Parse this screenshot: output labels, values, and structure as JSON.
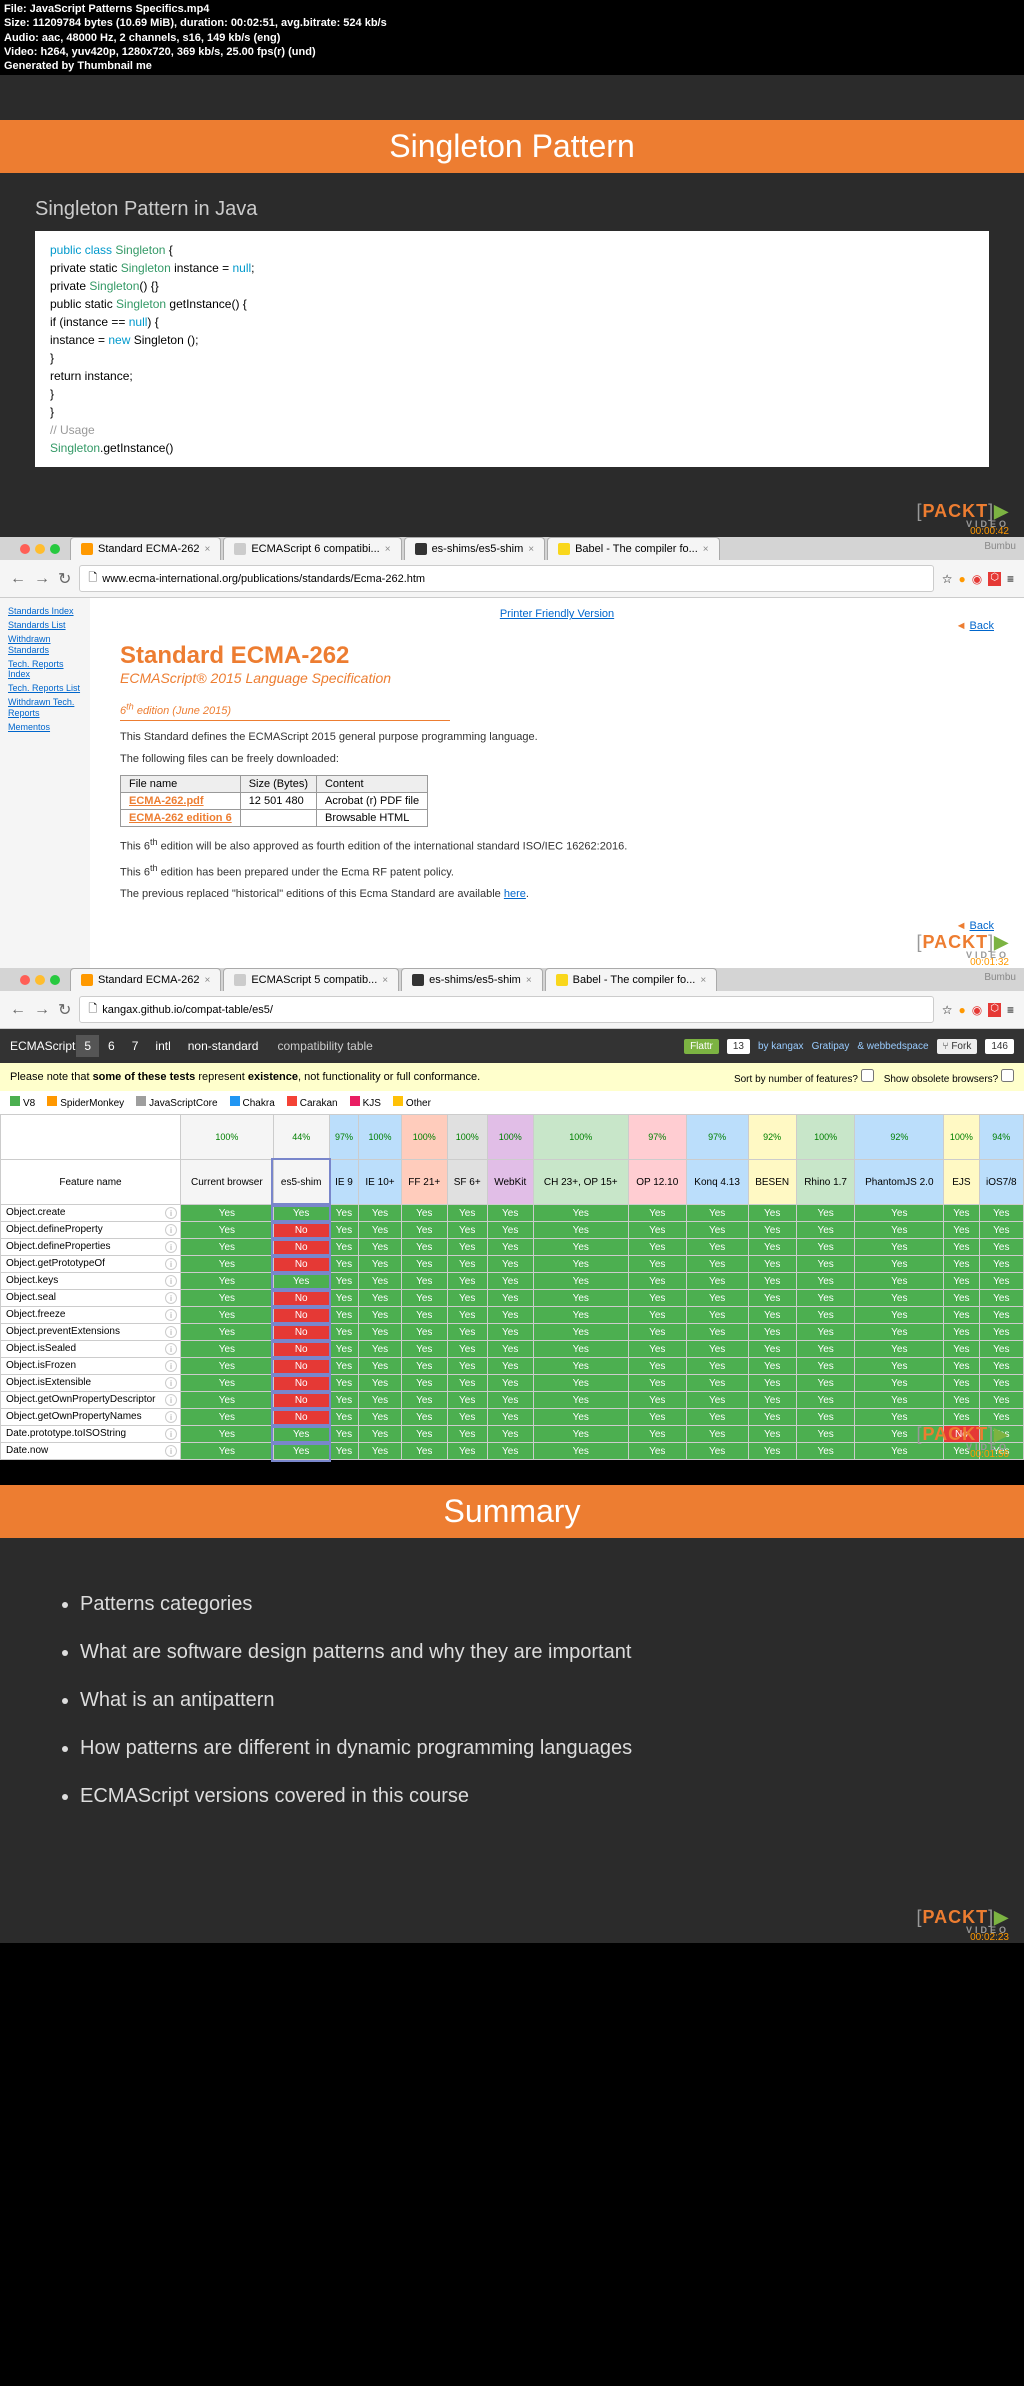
{
  "header": {
    "file": "JavaScript Patterns Specifics.mp4",
    "size": "11209784 bytes (10.69 MiB), duration: 00:02:51, avg.bitrate: 524 kb/s",
    "audio": "aac, 48000 Hz, 2 channels, s16, 149 kb/s (eng)",
    "video": "h264, yuv420p, 1280x720, 369 kb/s, 25.00 fps(r) (und)",
    "gen": "Generated by Thumbnail me"
  },
  "slide1": {
    "banner": "Singleton Pattern",
    "subtitle": "Singleton Pattern in Java",
    "timestamp": "00:00:42"
  },
  "code": {
    "l1a": "public class",
    "l1b": "Singleton",
    "l1c": " {",
    "l2a": "  private static ",
    "l2b": "Singleton",
    "l2c": " instance = ",
    "l2d": "null",
    "l2e": ";",
    "l3": " ",
    "l4a": "  private ",
    "l4b": "Singleton",
    "l4c": "() {}",
    "l5": " ",
    "l6a": "  public static ",
    "l6b": "Singleton",
    "l6c": " getInstance() {",
    "l7a": "    if (instance == ",
    "l7b": "null",
    "l7c": ") {",
    "l8a": "      instance = ",
    "l8b": "new",
    "l8c": " Singleton ();",
    "l9": "    }",
    "l10": "    return instance;",
    "l11": "  }",
    "l12": "}",
    "l13": " ",
    "l14": "// Usage",
    "l15a": "Singleton",
    "l15b": ".getInstance()"
  },
  "browser": {
    "tabs": [
      {
        "title": "Standard ECMA-262"
      },
      {
        "title": "ECMAScript 6 compatibi..."
      },
      {
        "title": "es-shims/es5-shim"
      },
      {
        "title": "Babel - The compiler fo..."
      }
    ],
    "url1": "www.ecma-international.org/publications/standards/Ecma-262.htm",
    "url2": "kangax.github.io/compat-table/es5/",
    "burmbu": "Bumbu"
  },
  "ecma": {
    "sidebar": [
      "Standards Index",
      "Standards List",
      "Withdrawn Standards",
      "Tech. Reports Index",
      "Tech. Reports List",
      "Withdrawn Tech. Reports",
      "Mementos"
    ],
    "printer": "Printer Friendly Version",
    "back": "Back",
    "title": "Standard ECMA-262",
    "sub": "ECMAScript® 2015 Language Specification",
    "ed": "6th edition (June 2015)",
    "p1": "This Standard defines the ECMAScript 2015 general purpose programming language.",
    "p2": "The following files can be freely downloaded:",
    "th1": "File name",
    "th2": "Size (Bytes)",
    "th3": "Content",
    "r1c1": "ECMA-262.pdf",
    "r1c2": "12 501 480",
    "r1c3": "Acrobat (r) PDF file",
    "r2c1": "ECMA-262 edition 6",
    "r2c2": "",
    "r2c3": "Browsable HTML",
    "p3a": "This 6",
    "p3b": " edition will be also approved as fourth edition of the international standard ISO/IEC 16262:2016.",
    "p4a": "This 6",
    "p4b": " edition has been prepared under the Ecma RF patent policy.",
    "p5a": "The previous replaced \"historical\" editions of this Ecma Standard are available ",
    "p5b": "here",
    "p5c": ".",
    "timestamp": "00:01:32"
  },
  "compat": {
    "nav_label": "ECMAScript",
    "nav_items": [
      "5",
      "6",
      "7",
      "intl",
      "non-standard"
    ],
    "nav_title": "compatibility table",
    "flattr": "Flattr",
    "flattr_n": "13",
    "by": "by kangax",
    "grat": "Gratipay",
    "webbed": "& webbedspace",
    "fork": "Fork",
    "fork_n": "146",
    "note": "Please note that some of these tests represent existence, not functionality or full conformance.",
    "sort_label": "Sort by number of features?",
    "obs_label": "Show obsolete browsers?",
    "legend": [
      "V8",
      "SpiderMonkey",
      "JavaScriptCore",
      "Chakra",
      "Carakan",
      "KJS",
      "Other"
    ],
    "legend_colors": [
      "#4caf50",
      "#ff9800",
      "#9e9e9e",
      "#2196f3",
      "#f44336",
      "#e91e63",
      "#ffc107"
    ],
    "col_feat": "Feature name",
    "cols": [
      "Current browser",
      "es5-shim",
      "IE 9",
      "IE 10+",
      "FF 21+",
      "SF 6+",
      "WebKit",
      "CH 23+, OP 15+",
      "OP 12.10",
      "Konq 4.13",
      "BESEN",
      "Rhino 1.7",
      "PhantomJS 2.0",
      "EJS",
      "iOS7/8"
    ],
    "pcts": [
      "100%",
      "44%",
      "97%",
      "100%",
      "100%",
      "100%",
      "100%",
      "100%",
      "97%",
      "97%",
      "92%",
      "100%",
      "92%",
      "100%",
      "94%",
      "100%"
    ],
    "features": [
      "Object.create",
      "Object.defineProperty",
      "Object.defineProperties",
      "Object.getPrototypeOf",
      "Object.keys",
      "Object.seal",
      "Object.freeze",
      "Object.preventExtensions",
      "Object.isSealed",
      "Object.isFrozen",
      "Object.isExtensible",
      "Object.getOwnPropertyDescriptor",
      "Object.getOwnPropertyNames",
      "Date.prototype.toISOString",
      "Date.now"
    ],
    "timestamp": "00:01:56"
  },
  "chart_data": {
    "type": "table",
    "title": "ECMAScript 5 compatibility table",
    "columns": [
      "Feature name",
      "Current browser",
      "es5-shim",
      "IE 9",
      "IE 10+",
      "FF 21+",
      "SF 6+",
      "WebKit",
      "CH 23+/OP 15+",
      "OP 12.10",
      "Konq 4.13",
      "BESEN",
      "Rhino 1.7",
      "PhantomJS 2.0",
      "EJS",
      "iOS7/8"
    ],
    "column_percentages": [
      null,
      100,
      44,
      97,
      100,
      100,
      100,
      100,
      100,
      97,
      97,
      92,
      100,
      92,
      100,
      94,
      100
    ],
    "rows": [
      {
        "feature": "Object.create",
        "values": [
          "Yes",
          "Yes",
          "Yes",
          "Yes",
          "Yes",
          "Yes",
          "Yes",
          "Yes",
          "Yes",
          "Yes",
          "Yes",
          "Yes",
          "Yes",
          "Yes",
          "Yes"
        ]
      },
      {
        "feature": "Object.defineProperty",
        "values": [
          "Yes",
          "No",
          "Yes",
          "Yes",
          "Yes",
          "Yes",
          "Yes",
          "Yes",
          "Yes",
          "Yes",
          "Yes",
          "Yes",
          "Yes",
          "Yes",
          "Yes"
        ]
      },
      {
        "feature": "Object.defineProperties",
        "values": [
          "Yes",
          "No",
          "Yes",
          "Yes",
          "Yes",
          "Yes",
          "Yes",
          "Yes",
          "Yes",
          "Yes",
          "Yes",
          "Yes",
          "Yes",
          "Yes",
          "Yes"
        ]
      },
      {
        "feature": "Object.getPrototypeOf",
        "values": [
          "Yes",
          "No",
          "Yes",
          "Yes",
          "Yes",
          "Yes",
          "Yes",
          "Yes",
          "Yes",
          "Yes",
          "Yes",
          "Yes",
          "Yes",
          "Yes",
          "Yes"
        ]
      },
      {
        "feature": "Object.keys",
        "values": [
          "Yes",
          "Yes",
          "Yes",
          "Yes",
          "Yes",
          "Yes",
          "Yes",
          "Yes",
          "Yes",
          "Yes",
          "Yes",
          "Yes",
          "Yes",
          "Yes",
          "Yes"
        ]
      },
      {
        "feature": "Object.seal",
        "values": [
          "Yes",
          "No",
          "Yes",
          "Yes",
          "Yes",
          "Yes",
          "Yes",
          "Yes",
          "Yes",
          "Yes",
          "Yes",
          "Yes",
          "Yes",
          "Yes",
          "Yes"
        ]
      },
      {
        "feature": "Object.freeze",
        "values": [
          "Yes",
          "No",
          "Yes",
          "Yes",
          "Yes",
          "Yes",
          "Yes",
          "Yes",
          "Yes",
          "Yes",
          "Yes",
          "Yes",
          "Yes",
          "Yes",
          "Yes"
        ]
      },
      {
        "feature": "Object.preventExtensions",
        "values": [
          "Yes",
          "No",
          "Yes",
          "Yes",
          "Yes",
          "Yes",
          "Yes",
          "Yes",
          "Yes",
          "Yes",
          "Yes",
          "Yes",
          "Yes",
          "Yes",
          "Yes"
        ]
      },
      {
        "feature": "Object.isSealed",
        "values": [
          "Yes",
          "No",
          "Yes",
          "Yes",
          "Yes",
          "Yes",
          "Yes",
          "Yes",
          "Yes",
          "Yes",
          "Yes",
          "Yes",
          "Yes",
          "Yes",
          "Yes"
        ]
      },
      {
        "feature": "Object.isFrozen",
        "values": [
          "Yes",
          "No",
          "Yes",
          "Yes",
          "Yes",
          "Yes",
          "Yes",
          "Yes",
          "Yes",
          "Yes",
          "Yes",
          "Yes",
          "Yes",
          "Yes",
          "Yes"
        ]
      },
      {
        "feature": "Object.isExtensible",
        "values": [
          "Yes",
          "No",
          "Yes",
          "Yes",
          "Yes",
          "Yes",
          "Yes",
          "Yes",
          "Yes",
          "Yes",
          "Yes",
          "Yes",
          "Yes",
          "Yes",
          "Yes"
        ]
      },
      {
        "feature": "Object.getOwnPropertyDescriptor",
        "values": [
          "Yes",
          "No",
          "Yes",
          "Yes",
          "Yes",
          "Yes",
          "Yes",
          "Yes",
          "Yes",
          "Yes",
          "Yes",
          "Yes",
          "Yes",
          "Yes",
          "Yes"
        ]
      },
      {
        "feature": "Object.getOwnPropertyNames",
        "values": [
          "Yes",
          "No",
          "Yes",
          "Yes",
          "Yes",
          "Yes",
          "Yes",
          "Yes",
          "Yes",
          "Yes",
          "Yes",
          "Yes",
          "Yes",
          "Yes",
          "Yes"
        ]
      },
      {
        "feature": "Date.prototype.toISOString",
        "values": [
          "Yes",
          "Yes",
          "Yes",
          "Yes",
          "Yes",
          "Yes",
          "Yes",
          "Yes",
          "Yes",
          "Yes",
          "Yes",
          "Yes",
          "Yes",
          "No",
          "Yes"
        ]
      },
      {
        "feature": "Date.now",
        "values": [
          "Yes",
          "Yes",
          "Yes",
          "Yes",
          "Yes",
          "Yes",
          "Yes",
          "Yes",
          "Yes",
          "Yes",
          "Yes",
          "Yes",
          "Yes",
          "Yes",
          "Yes"
        ]
      }
    ]
  },
  "summary": {
    "banner": "Summary",
    "items": [
      "Patterns categories",
      "What are software design patterns and why they are important",
      "What is an antipattern",
      "How patterns are different in dynamic programming languages",
      "ECMAScript versions covered in this course"
    ],
    "timestamp": "00:02:23"
  },
  "packt": {
    "name": "PACKT",
    "sub": "VIDEO"
  },
  "y": "Yes",
  "n": "No"
}
